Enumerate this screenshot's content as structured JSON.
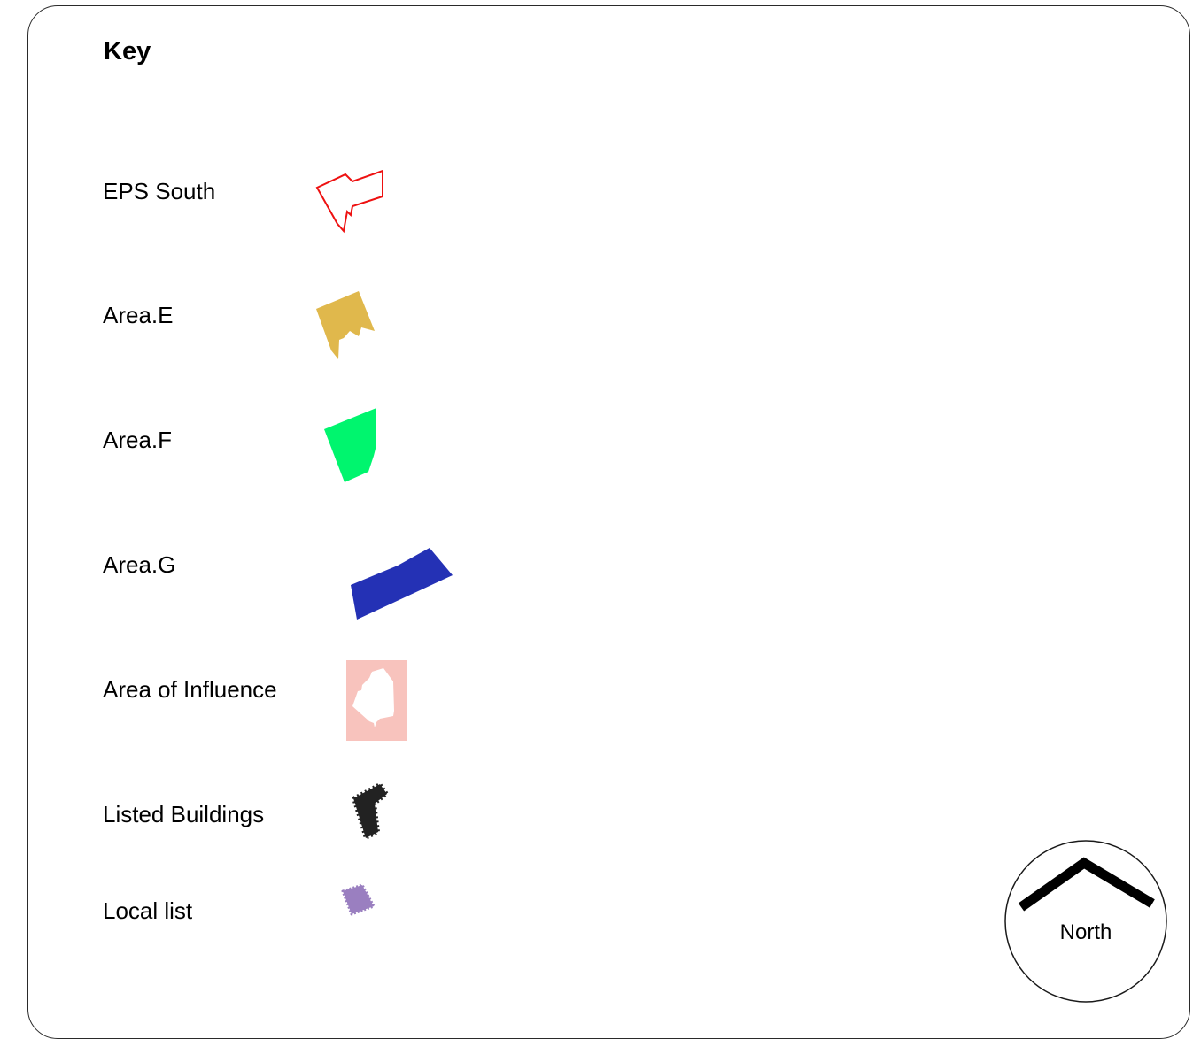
{
  "key": {
    "title": "Key"
  },
  "legend": [
    {
      "id": "eps-south",
      "label": "EPS South",
      "color": "#ee1111",
      "style": "outline"
    },
    {
      "id": "area-e",
      "label": "Area.E",
      "color": "#e0b84c",
      "style": "fill"
    },
    {
      "id": "area-f",
      "label": "Area.F",
      "color": "#00f56e",
      "style": "fill"
    },
    {
      "id": "area-g",
      "label": "Area.G",
      "color": "#2431b5",
      "style": "fill"
    },
    {
      "id": "area-of-influence",
      "label": "Area of Influence",
      "color": "#f8c3bd",
      "style": "fill-with-hole"
    },
    {
      "id": "listed-buildings",
      "label": "Listed Buildings",
      "color": "#222222",
      "style": "fill"
    },
    {
      "id": "local-list",
      "label": "Local list",
      "color": "#9a7fc0",
      "style": "fill"
    }
  ],
  "north_arrow": {
    "label": "North",
    "icon": "north-arrow-icon"
  }
}
